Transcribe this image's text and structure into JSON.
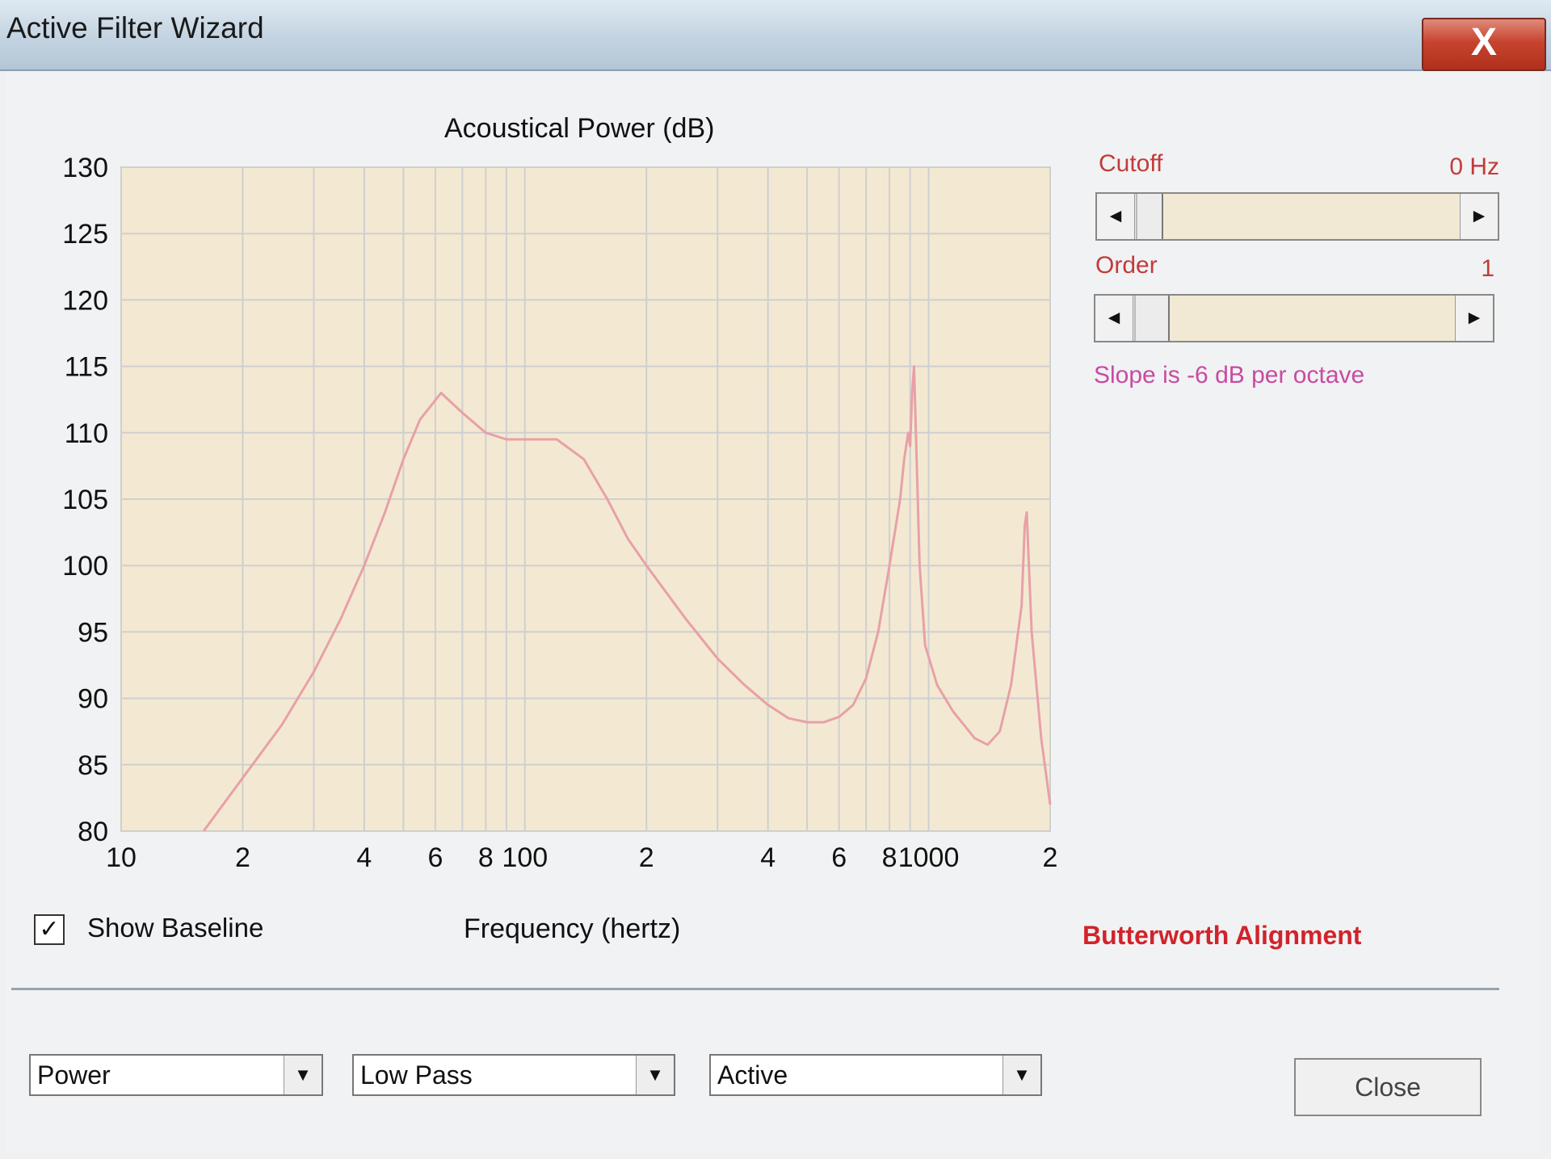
{
  "window": {
    "title": "Active Filter Wizard",
    "close_glyph": "X"
  },
  "chart_data": {
    "type": "line",
    "title": "Acoustical Power (dB)",
    "xlabel": "Frequency (hertz)",
    "ylabel": "",
    "xscale": "log",
    "xlim": [
      10,
      2000
    ],
    "ylim": [
      80,
      130
    ],
    "grid": true,
    "y_ticks": [
      130,
      125,
      120,
      115,
      110,
      105,
      100,
      95,
      90,
      85,
      80
    ],
    "x_ticks": [
      {
        "value": 10,
        "label": "10"
      },
      {
        "value": 20,
        "label": "2"
      },
      {
        "value": 40,
        "label": "4"
      },
      {
        "value": 60,
        "label": "6"
      },
      {
        "value": 80,
        "label": "8"
      },
      {
        "value": 100,
        "label": "100"
      },
      {
        "value": 200,
        "label": "2"
      },
      {
        "value": 400,
        "label": "4"
      },
      {
        "value": 600,
        "label": "6"
      },
      {
        "value": 800,
        "label": "8"
      },
      {
        "value": 1000,
        "label": "1000"
      },
      {
        "value": 2000,
        "label": "2"
      }
    ],
    "series": [
      {
        "color": "#e8a0a8",
        "points": [
          [
            16,
            80
          ],
          [
            20,
            84
          ],
          [
            25,
            88
          ],
          [
            30,
            92
          ],
          [
            35,
            96
          ],
          [
            40,
            100
          ],
          [
            45,
            104
          ],
          [
            50,
            108
          ],
          [
            55,
            111
          ],
          [
            62,
            113
          ],
          [
            70,
            111.5
          ],
          [
            80,
            110
          ],
          [
            90,
            109.5
          ],
          [
            100,
            109.5
          ],
          [
            120,
            109.5
          ],
          [
            140,
            108
          ],
          [
            160,
            105
          ],
          [
            180,
            102
          ],
          [
            200,
            100
          ],
          [
            250,
            96
          ],
          [
            300,
            93
          ],
          [
            350,
            91
          ],
          [
            400,
            89.5
          ],
          [
            450,
            88.5
          ],
          [
            500,
            88.2
          ],
          [
            550,
            88.2
          ],
          [
            600,
            88.6
          ],
          [
            650,
            89.5
          ],
          [
            700,
            91.5
          ],
          [
            750,
            95
          ],
          [
            800,
            100
          ],
          [
            850,
            105
          ],
          [
            870,
            108
          ],
          [
            890,
            110
          ],
          [
            900,
            109
          ],
          [
            910,
            113
          ],
          [
            920,
            115
          ],
          [
            930,
            110
          ],
          [
            950,
            100
          ],
          [
            980,
            94
          ],
          [
            1050,
            91
          ],
          [
            1150,
            89
          ],
          [
            1300,
            87
          ],
          [
            1400,
            86.5
          ],
          [
            1500,
            87.5
          ],
          [
            1600,
            91
          ],
          [
            1700,
            97
          ],
          [
            1730,
            103
          ],
          [
            1750,
            104
          ],
          [
            1800,
            95
          ],
          [
            1900,
            87
          ],
          [
            2000,
            82
          ]
        ]
      }
    ]
  },
  "controls": {
    "cutoff_label": "Cutoff",
    "cutoff_value": "0 Hz",
    "order_label": "Order",
    "order_value": "1",
    "slope_text": "Slope is -6 dB per octave",
    "alignment_text": "Butterworth Alignment",
    "left_arrow": "◄",
    "right_arrow": "►"
  },
  "baseline": {
    "label": "Show Baseline",
    "checked_glyph": "✓"
  },
  "combos": [
    {
      "value": "Power"
    },
    {
      "value": "Low Pass"
    },
    {
      "value": "Active"
    }
  ],
  "combo_arrow": "▼",
  "buttons": {
    "close": "Close"
  }
}
